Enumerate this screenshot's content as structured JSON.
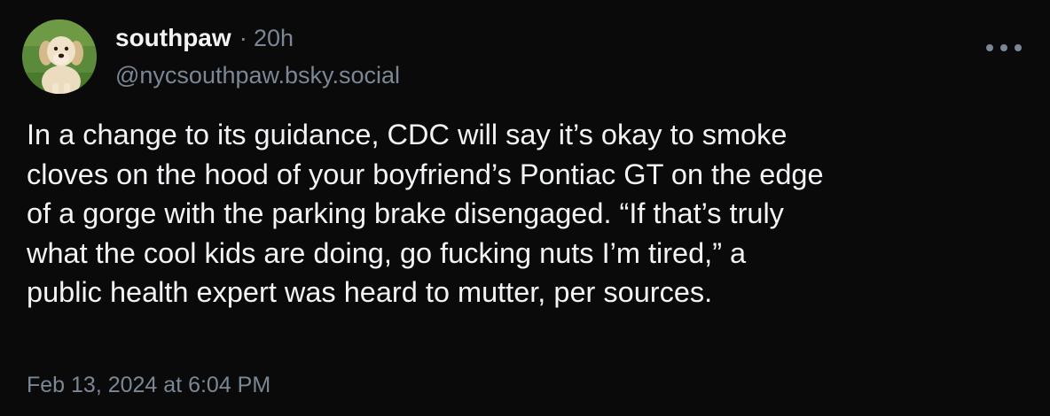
{
  "post": {
    "author": {
      "display_name": "southpaw",
      "separator": "·",
      "relative_time": "20h",
      "handle": "@nycsouthpaw.bsky.social",
      "avatar": "golden-retriever-puppy-photo"
    },
    "text_lines": [
      "In a change to its guidance, CDC will say it’s okay to smoke",
      "cloves on the hood of your boyfriend’s Pontiac GT on the edge",
      "of a gorge with the parking brake disengaged. “If that’s truly",
      "what the cool kids are doing, go fucking nuts I’m tired,” a",
      "public health expert was heard to mutter, per sources."
    ],
    "timestamp": "Feb 13, 2024 at 6:04 PM",
    "more_icon": "ellipsis-icon"
  },
  "colors": {
    "background": "#0a0a0b",
    "text": "#f1f3f5",
    "muted": "#7b8794"
  }
}
